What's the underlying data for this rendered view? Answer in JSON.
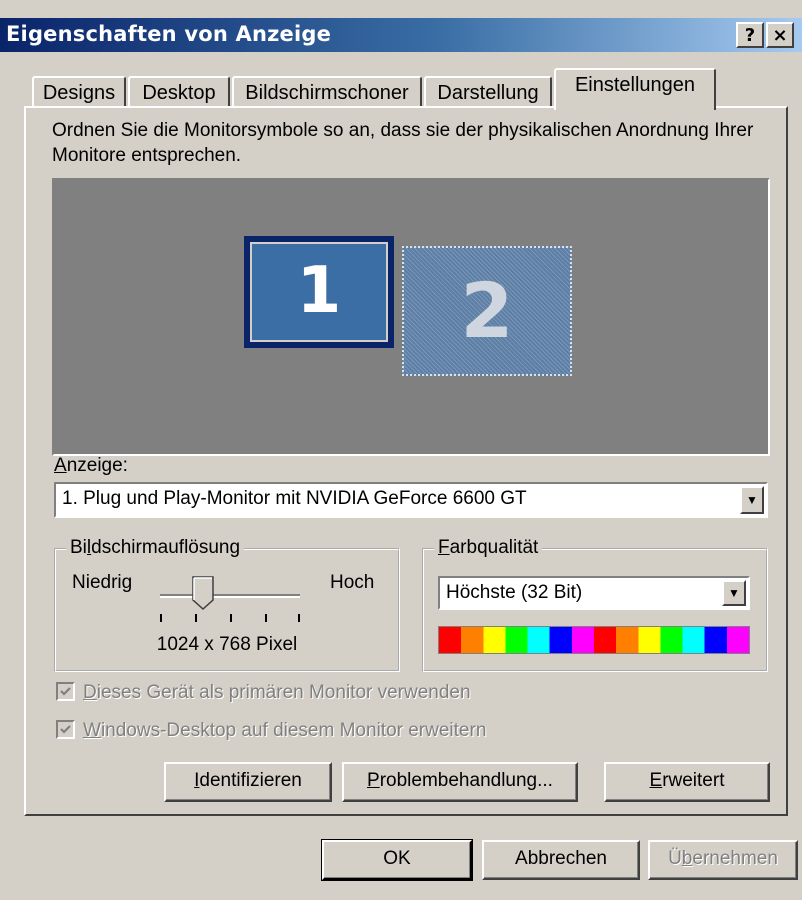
{
  "window": {
    "title": "Eigenschaften von Anzeige",
    "help_label": "?",
    "close_label": "×"
  },
  "tabs": [
    {
      "label": "Designs",
      "active": false
    },
    {
      "label": "Desktop",
      "active": false
    },
    {
      "label": "Bildschirmschoner",
      "active": false
    },
    {
      "label": "Darstellung",
      "active": false
    },
    {
      "label": "Einstellungen",
      "active": true
    }
  ],
  "settings": {
    "instruction": "Ordnen Sie die Monitorsymbole so an, dass sie der physikalischen Anordnung Ihrer Monitore entsprechen.",
    "monitors": [
      {
        "label": "1",
        "selected": true
      },
      {
        "label": "2",
        "selected": false
      }
    ],
    "display_label": "Anzeige:",
    "display_value": "1. Plug und Play-Monitor mit NVIDIA GeForce 6600 GT",
    "resolution": {
      "group_label": "Bildschirmauflösung",
      "low_label": "Niedrig",
      "high_label": "Hoch",
      "value": "1024 x 768 Pixel",
      "slider_position": 0.25
    },
    "color": {
      "group_label": "Farbqualität",
      "value": "Höchste (32 Bit)",
      "spectrum": [
        "#ff0000",
        "#ff8000",
        "#ffff00",
        "#00ff00",
        "#00ffff",
        "#0000ff",
        "#ff00ff"
      ]
    },
    "checkboxes": {
      "primary": {
        "label": "Dieses Gerät als primären Monitor verwenden",
        "checked": true,
        "disabled": true
      },
      "extend": {
        "label": "Windows-Desktop auf diesem Monitor erweitern",
        "checked": true,
        "disabled": true
      }
    },
    "buttons": {
      "identify": "Identifizieren",
      "troubleshoot": "Problembehandlung...",
      "advanced": "Erweitert"
    }
  },
  "footer": {
    "ok": "OK",
    "cancel": "Abbrechen",
    "apply": "Übernehmen"
  },
  "colors": {
    "titlebar_start": "#0a246a",
    "titlebar_end": "#a6caf0",
    "face": "#d4d0c8",
    "preview_bg": "#808080",
    "monitor_selected": "#3a6ea5"
  }
}
